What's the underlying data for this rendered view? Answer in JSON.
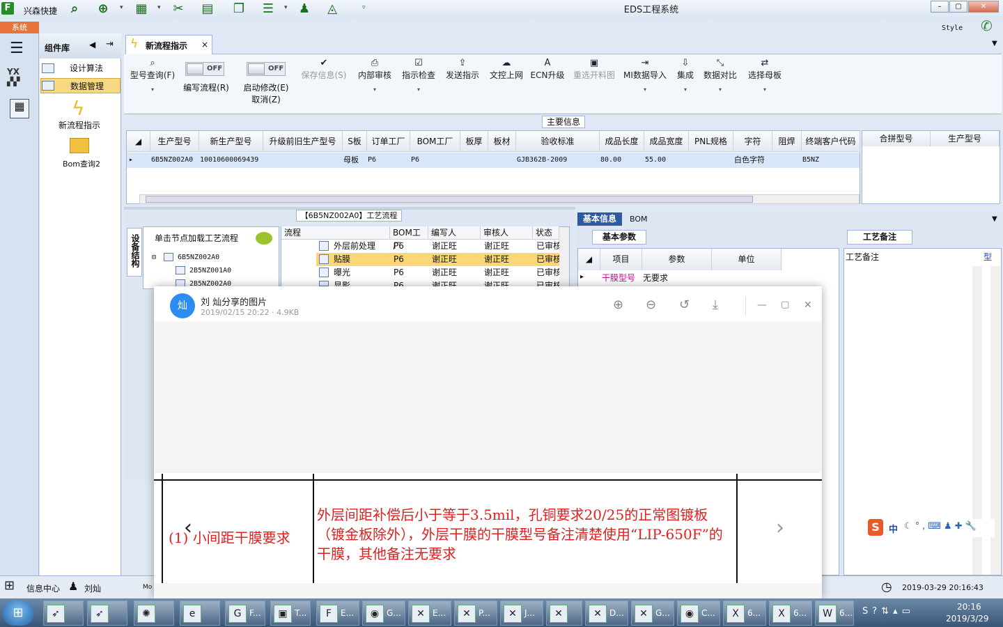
{
  "window": {
    "title": "EDS工程系统",
    "app_logo": "F",
    "quick_label": "兴森快捷",
    "min": "–",
    "max": "▢",
    "close": "✕"
  },
  "menubar": {
    "system_tab": "系统",
    "style_label": "Style"
  },
  "left_panel": {
    "title": "组件库",
    "items": [
      {
        "label": "设计算法"
      },
      {
        "label": "数据管理"
      }
    ],
    "tiles": [
      {
        "label": "新流程指示"
      },
      {
        "label": "Bom查询2"
      }
    ]
  },
  "doc_tab": {
    "label": "新流程指示",
    "close": "×"
  },
  "toolbar": {
    "buttons": [
      {
        "label": "型号查询(F)",
        "icon": "search-icon",
        "glyph": "⌕"
      },
      {
        "label": "保存信息(S)",
        "icon": "check-icon",
        "glyph": "✔"
      },
      {
        "label": "内部审核",
        "icon": "printer-icon",
        "glyph": "⎙"
      },
      {
        "label": "指示检查",
        "icon": "check-box-icon",
        "glyph": "☑"
      },
      {
        "label": "发送指示",
        "icon": "upload-icon",
        "glyph": "⇪"
      },
      {
        "label": "文控上网",
        "icon": "cloud-upload-icon",
        "glyph": "☁"
      },
      {
        "label": "ECN升级",
        "icon": "a-icon",
        "glyph": "A"
      },
      {
        "label": "重选开料图",
        "icon": "image-icon",
        "glyph": "▣"
      },
      {
        "label": "MI数据导入",
        "icon": "import-icon",
        "glyph": "⇥"
      },
      {
        "label": "集成",
        "icon": "download-icon",
        "glyph": "⇩"
      },
      {
        "label": "数据对比",
        "icon": "compare-icon",
        "glyph": "⤡"
      },
      {
        "label": "选择母板",
        "icon": "shuffle-icon",
        "glyph": "⇄"
      }
    ],
    "toggles": [
      {
        "state": "OFF",
        "label": "编写流程(R)"
      },
      {
        "state": "OFF",
        "label": "启动修改(E)",
        "label2": "取消(Z)"
      }
    ]
  },
  "main_info": {
    "label": "主要信息",
    "columns": [
      "生产型号",
      "新生产型号",
      "升级前旧生产型号",
      "S板",
      "订单工厂",
      "BOM工厂",
      "板厚",
      "板材",
      "验收标准",
      "成品长度",
      "成品宽度",
      "PNL规格",
      "字符",
      "阻焊",
      "终端客户代码"
    ],
    "row": [
      "6B5NZ002A0",
      "10010600069439",
      "",
      "母板",
      "P6",
      "P6",
      "",
      "",
      "GJB362B-2009",
      "80.00",
      "55.00",
      "",
      "白色字符",
      "",
      "B5NZ"
    ],
    "right_columns": [
      "合拼型号",
      "生产型号"
    ]
  },
  "process": {
    "title": "【6B5NZ002A0】工艺流程",
    "equip_tab": "设备结构",
    "hint": "单击节点加载工艺流程",
    "tree": [
      "6B5NZ002A0",
      "2B5NZ001A0",
      "2B5NZ002A0"
    ],
    "columns": [
      "流程",
      "BOM工厂",
      "编写人",
      "审核人",
      "状态"
    ],
    "rows": [
      {
        "name": "外层前处理",
        "factory": "P6",
        "writer": "谢正旺",
        "reviewer": "谢正旺",
        "status": "已审核"
      },
      {
        "name": "贴膜",
        "factory": "P6",
        "writer": "谢正旺",
        "reviewer": "谢正旺",
        "status": "已审核"
      },
      {
        "name": "曝光",
        "factory": "P6",
        "writer": "谢正旺",
        "reviewer": "谢正旺",
        "status": "已审核"
      },
      {
        "name": "显影",
        "factory": "P6",
        "writer": "谢正旺",
        "reviewer": "谢正旺",
        "status": "已审核"
      }
    ]
  },
  "basic": {
    "tab_active": "基本信息",
    "tab_other": "BOM",
    "params_tab": "基本参数",
    "columns": [
      "项目",
      "参数",
      "单位"
    ],
    "row": {
      "item": "干膜型号",
      "value": "无要求"
    },
    "notes_tab": "工艺备注",
    "notes_header": "工艺备注",
    "notes_header2": "型"
  },
  "ime": {
    "logo": "S",
    "mode": "中",
    "icons": "☾°,⌨♟✚🔧"
  },
  "status": {
    "info": "信息中心",
    "user": "刘灿",
    "mo": "Mo",
    "datetime": "2019-03-29 20:16:43"
  },
  "viewer": {
    "avatar": "灿",
    "title": "刘 灿分享的图片",
    "meta": "2019/02/15 20:22 · 4.9KB",
    "image_left": "(1) 小间距干膜要求",
    "image_right": "外层间距补偿后小于等于3.5mil，孔铜要求20/25的正常图镀板（镀金板除外），外层干膜的干膜型号备注清楚使用“LIP-650F”的干膜，其他备注无要求"
  },
  "taskbar": {
    "items": [
      {
        "label": "F..."
      },
      {
        "label": "T..."
      },
      {
        "label": "E..."
      },
      {
        "label": "G..."
      },
      {
        "label": "E..."
      },
      {
        "label": "P..."
      },
      {
        "label": "J..."
      },
      {
        "label": ""
      },
      {
        "label": "D..."
      },
      {
        "label": "G..."
      },
      {
        "label": "C..."
      },
      {
        "label": "6..."
      },
      {
        "label": "6..."
      },
      {
        "label": "6..."
      }
    ],
    "time": "20:16",
    "date": "2019/3/29"
  }
}
